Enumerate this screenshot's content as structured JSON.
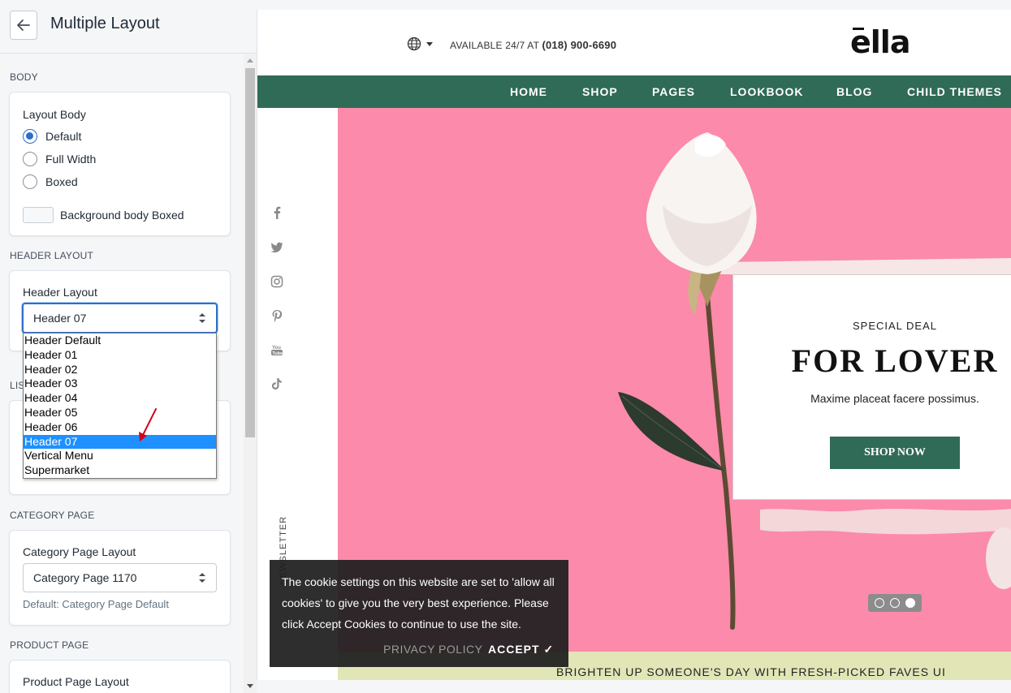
{
  "panel": {
    "title": "Multiple Layout"
  },
  "sections": {
    "body": {
      "title": "BODY",
      "label": "Layout Body",
      "options": [
        "Default",
        "Full Width",
        "Boxed"
      ],
      "selected": "Default",
      "swatch_label": "Background body Boxed"
    },
    "header": {
      "title": "HEADER LAYOUT",
      "label": "Header Layout",
      "selected": "Header 07",
      "options": [
        "Header Default",
        "Header 01",
        "Header 02",
        "Header 03",
        "Header 04",
        "Header 05",
        "Header 06",
        "Header 07",
        "Vertical Menu",
        "Supermarket"
      ]
    },
    "list_partial": "LIS",
    "category": {
      "title": "CATEGORY PAGE",
      "label": "Category Page Layout",
      "selected": "Category Page 1170",
      "help": "Default: Category Page Default"
    },
    "product": {
      "title": "PRODUCT PAGE",
      "label": "Product Page Layout"
    }
  },
  "preview": {
    "available_prefix": "AVAILABLE 24/7 AT",
    "phone": "(018) 900-6690",
    "logo": "ella",
    "nav": [
      "HOME",
      "SHOP",
      "PAGES",
      "LOOKBOOK",
      "BLOG",
      "CHILD THEMES"
    ],
    "newsletter": "NEWSLETTER",
    "deal": {
      "kicker": "SPECIAL DEAL",
      "title": "FOR LOVER",
      "subtitle": "Maxime placeat facere possimus.",
      "button": "SHOP NOW"
    },
    "cookie": {
      "text": "The cookie settings on this website are set to 'allow all cookies' to give you the very best experience. Please click Accept Cookies to continue to use the site.",
      "privacy": "PRIVACY POLICY",
      "accept": "ACCEPT ✓"
    },
    "promo": "BRIGHTEN UP SOMEONE'S DAY WITH FRESH-PICKED FAVES UI",
    "slider": {
      "count": 3,
      "active_index": 2
    }
  },
  "colors": {
    "accent": "#2c6ecb",
    "nav_green": "#2f6b57",
    "hero_pink": "#fb8aab",
    "promo_bg": "#e2e6b7",
    "annotation_red": "#d0021b"
  },
  "icons": [
    "back-arrow-icon",
    "globe-icon",
    "facebook-icon",
    "twitter-icon",
    "instagram-icon",
    "pinterest-icon",
    "youtube-icon",
    "tiktok-icon",
    "checkmark-icon"
  ]
}
